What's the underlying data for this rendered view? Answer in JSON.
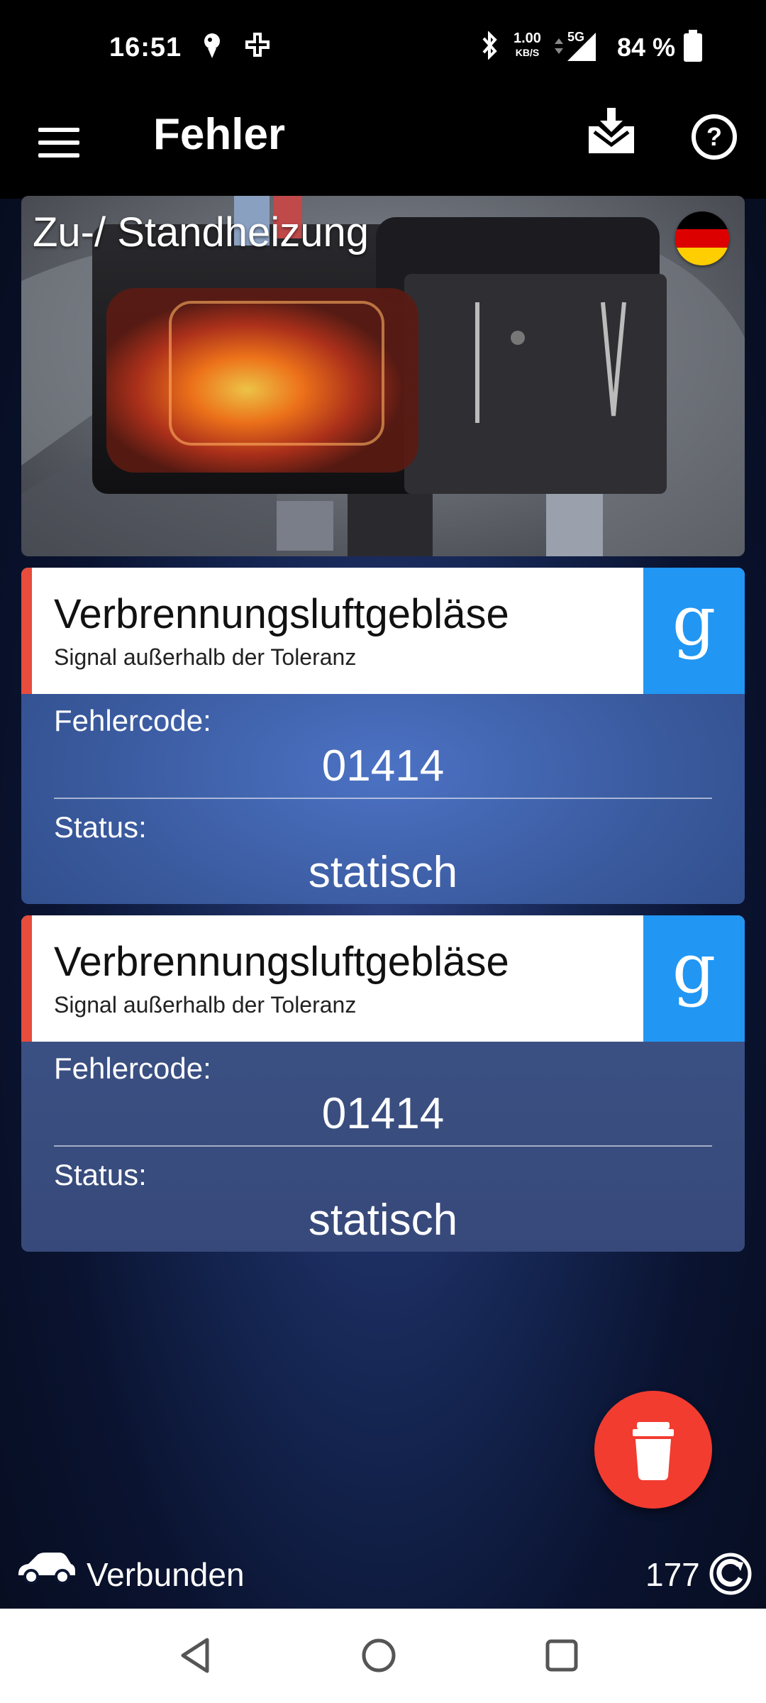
{
  "status_bar": {
    "time": "16:51",
    "net_speed_value": "1.00",
    "net_speed_unit": "KB/S",
    "network_type": "5G",
    "battery": "84 %",
    "icons": [
      "notification-icon",
      "medical-icon",
      "bluetooth-icon",
      "signal-icon",
      "battery-icon"
    ]
  },
  "app_bar": {
    "title": "Fehler",
    "icons": [
      "menu-icon",
      "inbox-download-icon",
      "help-icon"
    ]
  },
  "hero": {
    "title": "Zu-/ Standheizung",
    "flag": "germany-flag-icon"
  },
  "errors": [
    {
      "name": "Verbrennungsluftgebläse",
      "description": "Signal außerhalb der Toleranz",
      "code_label": "Fehlercode:",
      "code": "01414",
      "status_label": "Status:",
      "status": "statisch",
      "search_icon": "g"
    },
    {
      "name": "Verbrennungsluftgebläse",
      "description": "Signal außerhalb der Toleranz",
      "code_label": "Fehlercode:",
      "code": "01414",
      "status_label": "Status:",
      "status": "statisch",
      "search_icon": "g"
    }
  ],
  "footer": {
    "connection": "Verbunden",
    "count": "177"
  },
  "colors": {
    "accent_red": "#e74c3c",
    "fab_red": "#f23c30",
    "google_blue": "#2196f3"
  }
}
